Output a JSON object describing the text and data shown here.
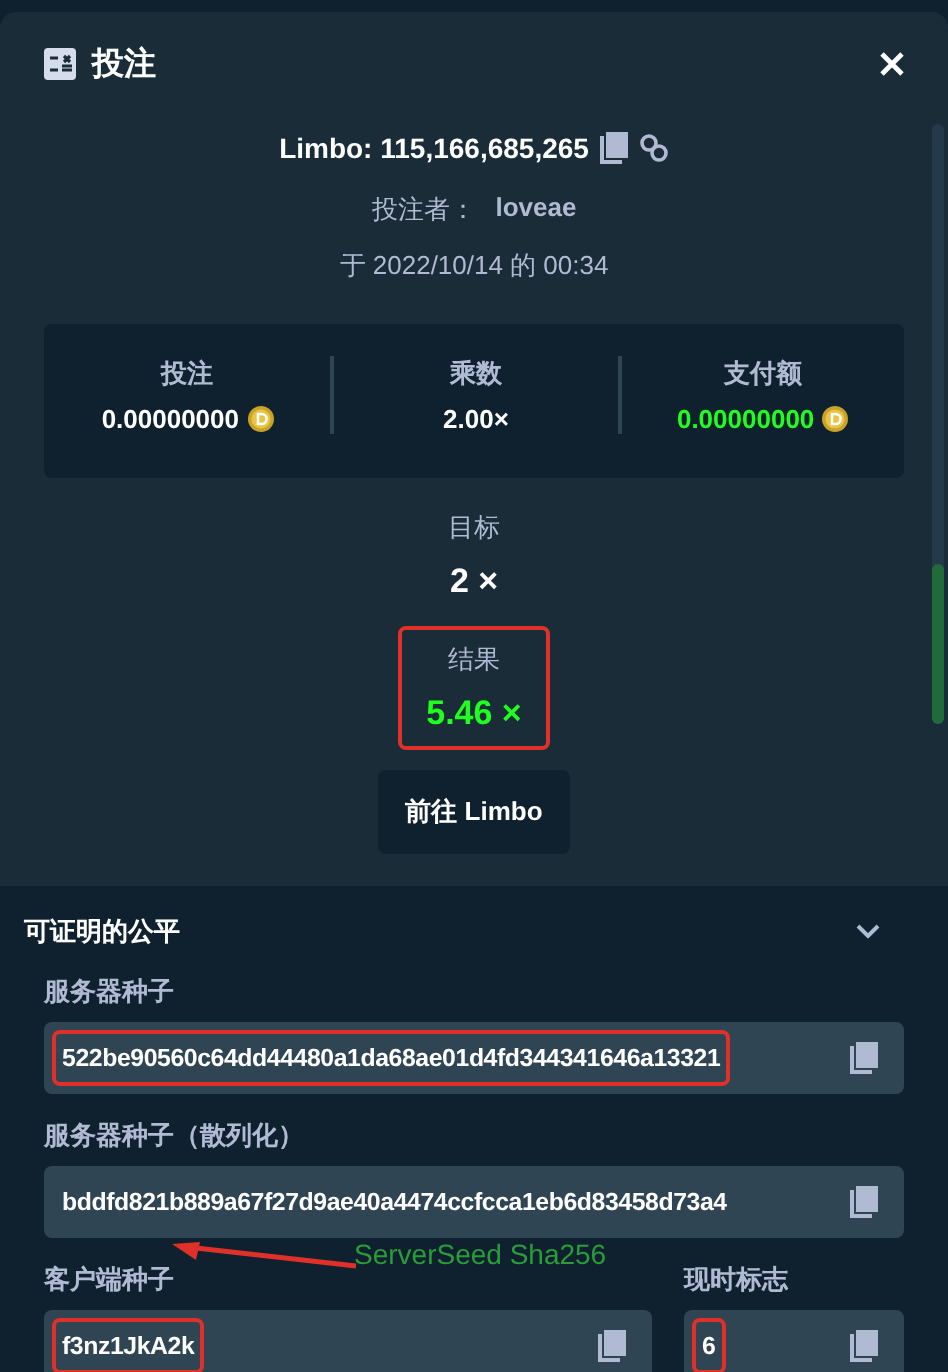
{
  "dialog": {
    "title": "投注",
    "game_id": "Limbo: 115,166,685,265",
    "bettor_label": "投注者：",
    "bettor": "loveae",
    "date": "于 2022/10/14 的 00:34"
  },
  "stats": [
    {
      "label": "投注",
      "value": "0.00000000",
      "coin": true,
      "kind": "neutral"
    },
    {
      "label": "乘数",
      "value": "2.00×",
      "coin": false,
      "kind": "neutral"
    },
    {
      "label": "支付额",
      "value": "0.00000000",
      "coin": true,
      "kind": "win"
    }
  ],
  "target": {
    "label": "目标",
    "value": "2 ×"
  },
  "result": {
    "label": "结果",
    "value": "5.46 ×",
    "highlighted": true
  },
  "button": "前往 Limbo",
  "fairness": {
    "title": "可证明的公平",
    "expanded": true,
    "server_seed": {
      "label": "服务器种子",
      "value": "522be90560c64dd44480a1da68ae01d4fd344341646a13321",
      "highlighted": true
    },
    "server_seed_hashed": {
      "label": "服务器种子（散列化）",
      "value": "bddfd821b889a67f27d9ae40a4474ccfcca1eb6d83458d73a4",
      "highlighted": false
    },
    "client_seed": {
      "label": "客户端种子",
      "value": "f3nz1JkA2k",
      "highlighted": true
    },
    "nonce": {
      "label": "现时标志",
      "value": "6",
      "highlighted": true
    },
    "annotation": "ServerSeed Sha256"
  }
}
